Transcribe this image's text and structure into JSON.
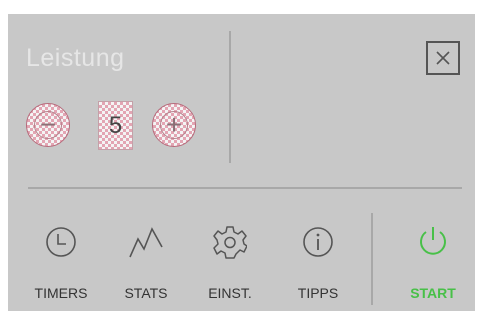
{
  "header": {
    "title": "Leistung"
  },
  "power": {
    "value": "5",
    "decrease_symbol": "−",
    "increase_symbol": "+",
    "decrease_icon": "minus-circle-icon",
    "increase_icon": "plus-circle-icon"
  },
  "close": {
    "icon": "close-icon"
  },
  "nav": {
    "items": [
      {
        "label": "TIMERS",
        "icon": "clock-icon"
      },
      {
        "label": "STATS",
        "icon": "graph-icon"
      },
      {
        "label": "EINST.",
        "icon": "gear-icon"
      },
      {
        "label": "TIPPS",
        "icon": "info-icon"
      }
    ],
    "start": {
      "label": "START",
      "icon": "power-icon"
    }
  },
  "colors": {
    "panel_bg": "#c8c8c8",
    "title": "#e6e6e6",
    "start_green": "#48c048",
    "icon": "#555555",
    "label": "#333333"
  }
}
